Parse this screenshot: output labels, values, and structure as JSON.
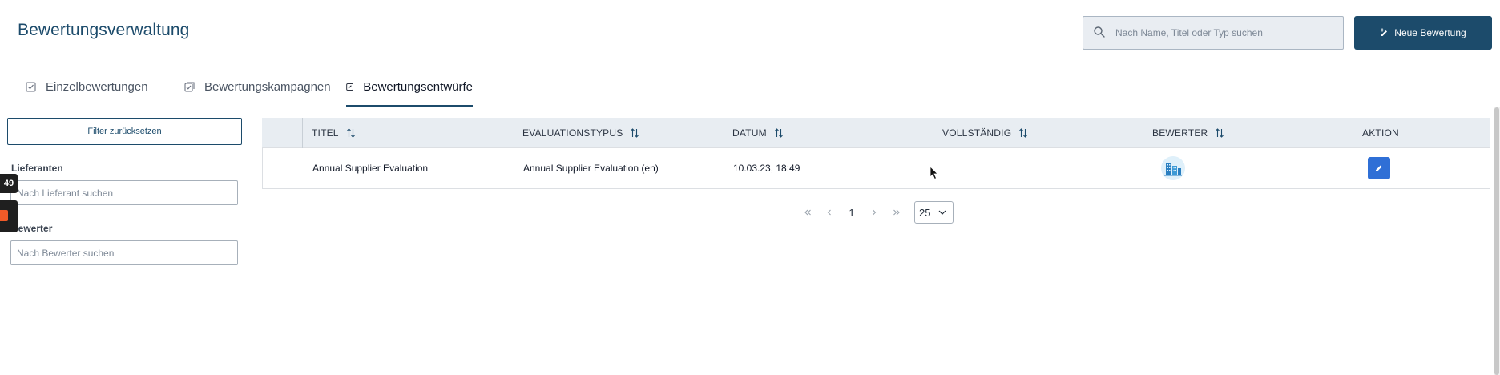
{
  "header": {
    "title": "Bewertungsverwaltung",
    "search_placeholder": "Nach Name, Titel oder Typ suchen",
    "search_icon": "search-icon",
    "new_button_label": "Neue Bewertung",
    "new_button_icon": "edit-plus-icon",
    "accent_color": "#1c4b6b"
  },
  "tabs": [
    {
      "label": "Einzelbewertungen",
      "icon": "checkbox-icon",
      "active": false
    },
    {
      "label": "Bewertungskampagnen",
      "icon": "checklist-icon",
      "active": false
    },
    {
      "label": "Bewertungsentwürfe",
      "icon": "draft-edit-icon",
      "active": true
    }
  ],
  "filters": {
    "reset_label": "Filter zurücksetzen",
    "supplier_label": "Lieferanten",
    "supplier_placeholder": "Nach Lieferant suchen",
    "evaluator_label": "Bewerter",
    "evaluator_placeholder": "Nach Bewerter suchen"
  },
  "side_badge": "49",
  "table": {
    "columns": [
      {
        "label": "TITEL",
        "sortable": true
      },
      {
        "label": "EVALUATIONSTYPUS",
        "sortable": true
      },
      {
        "label": "DATUM",
        "sortable": true
      },
      {
        "label": "VOLLSTÄNDIG",
        "sortable": true
      },
      {
        "label": "BEWERTER",
        "sortable": true
      },
      {
        "label": "AKTION",
        "sortable": false
      }
    ],
    "rows": [
      {
        "title": "Annual Supplier Evaluation",
        "type": "Annual Supplier Evaluation (en)",
        "date": "10.03.23, 18:49",
        "complete": "",
        "evaluator_icon": "building-avatar-icon",
        "action_icon": "pencil-icon"
      }
    ]
  },
  "pagination": {
    "current_page": "1",
    "page_size": "25"
  }
}
